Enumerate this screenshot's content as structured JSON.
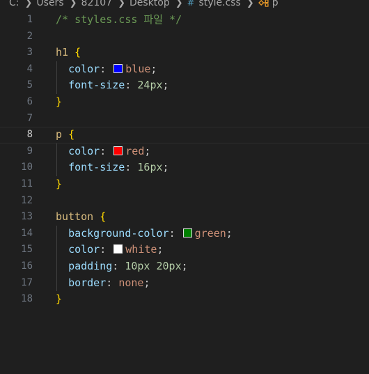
{
  "breadcrumb": {
    "drive": "C:",
    "folders": [
      "Users",
      "82107",
      "Desktop"
    ],
    "file": "style.css",
    "file_icon": "hash-icon",
    "symbol": "p",
    "symbol_icon": "symbol-class-icon"
  },
  "editor": {
    "current_line": 8,
    "lines": [
      {
        "n": "1",
        "tokens": [
          {
            "t": "/* styles.css 파일 */",
            "c": "comment"
          }
        ]
      },
      {
        "n": "2",
        "tokens": []
      },
      {
        "n": "3",
        "tokens": [
          {
            "t": "h1",
            "c": "selector"
          },
          {
            "t": " ",
            "c": "punct"
          },
          {
            "t": "{",
            "c": "brace"
          }
        ]
      },
      {
        "n": "4",
        "indent": true,
        "tokens": [
          {
            "t": "color",
            "c": "prop"
          },
          {
            "t": ": ",
            "c": "punct"
          },
          {
            "swatch": "#0000ff"
          },
          {
            "t": "blue",
            "c": "value"
          },
          {
            "t": ";",
            "c": "punct"
          }
        ]
      },
      {
        "n": "5",
        "indent": true,
        "tokens": [
          {
            "t": "font-size",
            "c": "prop"
          },
          {
            "t": ": ",
            "c": "punct"
          },
          {
            "t": "24px",
            "c": "num"
          },
          {
            "t": ";",
            "c": "punct"
          }
        ]
      },
      {
        "n": "6",
        "tokens": [
          {
            "t": "}",
            "c": "brace"
          }
        ]
      },
      {
        "n": "7",
        "tokens": []
      },
      {
        "n": "8",
        "tokens": [
          {
            "t": "p",
            "c": "selector"
          },
          {
            "t": " ",
            "c": "punct"
          },
          {
            "t": "{",
            "c": "brace"
          }
        ]
      },
      {
        "n": "9",
        "indent": true,
        "tokens": [
          {
            "t": "color",
            "c": "prop"
          },
          {
            "t": ": ",
            "c": "punct"
          },
          {
            "swatch": "#ff0000"
          },
          {
            "t": "red",
            "c": "value"
          },
          {
            "t": ";",
            "c": "punct"
          }
        ]
      },
      {
        "n": "10",
        "indent": true,
        "tokens": [
          {
            "t": "font-size",
            "c": "prop"
          },
          {
            "t": ": ",
            "c": "punct"
          },
          {
            "t": "16px",
            "c": "num"
          },
          {
            "t": ";",
            "c": "punct"
          }
        ]
      },
      {
        "n": "11",
        "tokens": [
          {
            "t": "}",
            "c": "brace"
          }
        ]
      },
      {
        "n": "12",
        "tokens": []
      },
      {
        "n": "13",
        "tokens": [
          {
            "t": "button",
            "c": "selector"
          },
          {
            "t": " ",
            "c": "punct"
          },
          {
            "t": "{",
            "c": "brace"
          }
        ]
      },
      {
        "n": "14",
        "indent": true,
        "tokens": [
          {
            "t": "background-color",
            "c": "prop"
          },
          {
            "t": ": ",
            "c": "punct"
          },
          {
            "swatch": "#008000"
          },
          {
            "t": "green",
            "c": "value"
          },
          {
            "t": ";",
            "c": "punct"
          }
        ]
      },
      {
        "n": "15",
        "indent": true,
        "tokens": [
          {
            "t": "color",
            "c": "prop"
          },
          {
            "t": ": ",
            "c": "punct"
          },
          {
            "swatch": "#ffffff"
          },
          {
            "t": "white",
            "c": "value"
          },
          {
            "t": ";",
            "c": "punct"
          }
        ]
      },
      {
        "n": "16",
        "indent": true,
        "tokens": [
          {
            "t": "padding",
            "c": "prop"
          },
          {
            "t": ": ",
            "c": "punct"
          },
          {
            "t": "10px 20px",
            "c": "num"
          },
          {
            "t": ";",
            "c": "punct"
          }
        ]
      },
      {
        "n": "17",
        "indent": true,
        "tokens": [
          {
            "t": "border",
            "c": "prop"
          },
          {
            "t": ": ",
            "c": "punct"
          },
          {
            "t": "none",
            "c": "value"
          },
          {
            "t": ";",
            "c": "punct"
          }
        ]
      },
      {
        "n": "18",
        "tokens": [
          {
            "t": "}",
            "c": "brace"
          }
        ]
      }
    ]
  }
}
